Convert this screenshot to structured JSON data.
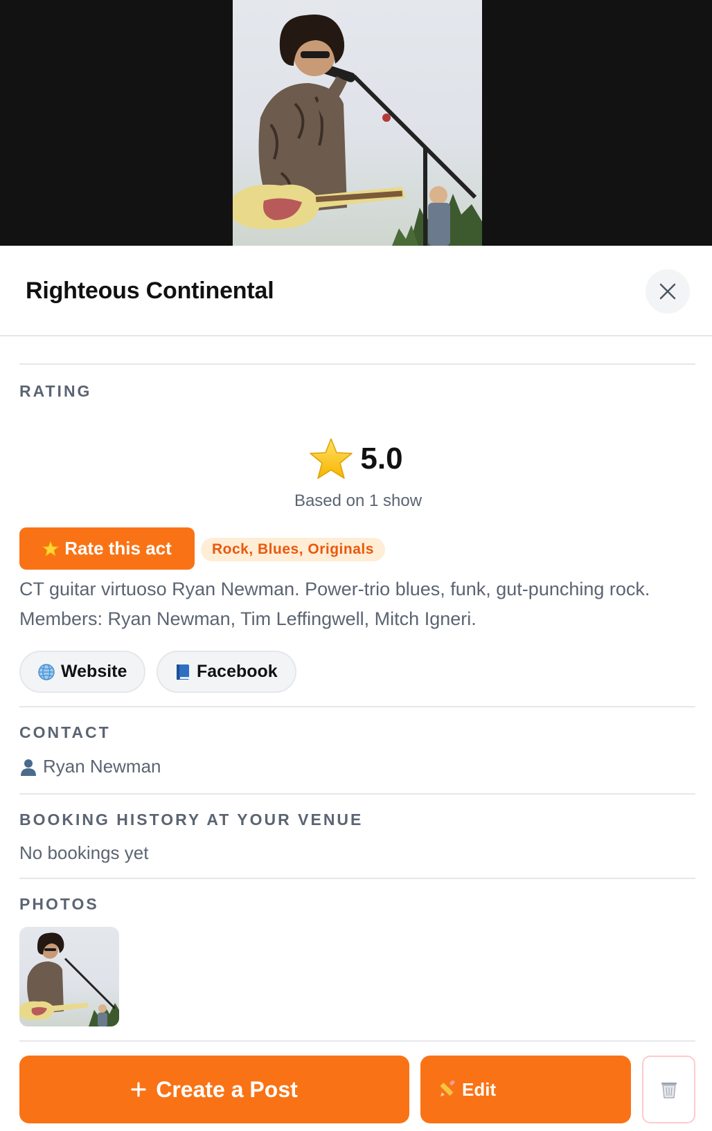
{
  "act": {
    "name": "Righteous Continental"
  },
  "close": {
    "icon": "close-icon"
  },
  "rating": {
    "section_label": "RATING",
    "value": "5.0",
    "subtext": "Based on 1 show",
    "icon": "star-icon"
  },
  "actions": {
    "rate_label": "Rate this act",
    "genres": "Rock, Blues, Originals"
  },
  "description": "CT guitar virtuoso Ryan Newman. Power-trio blues, funk, gut-punching rock. Members: Ryan Newman, Tim Leffingwell, Mitch Igneri.",
  "links": [
    {
      "label": "Website",
      "icon": "globe-icon"
    },
    {
      "label": "Facebook",
      "icon": "book-icon"
    }
  ],
  "contact": {
    "section_label": "CONTACT",
    "name": "Ryan Newman",
    "icon": "person-icon"
  },
  "booking_history": {
    "section_label": "BOOKING HISTORY AT YOUR VENUE",
    "empty_text": "No bookings yet"
  },
  "photos": {
    "section_label": "PHOTOS"
  },
  "footer": {
    "create_post_label": "Create a Post",
    "edit_label": "Edit",
    "delete_icon": "trash-icon"
  },
  "colors": {
    "accent": "#f97316",
    "badge_bg": "#ffedd5",
    "badge_text": "#ea580c",
    "muted_text": "#5b6472"
  }
}
